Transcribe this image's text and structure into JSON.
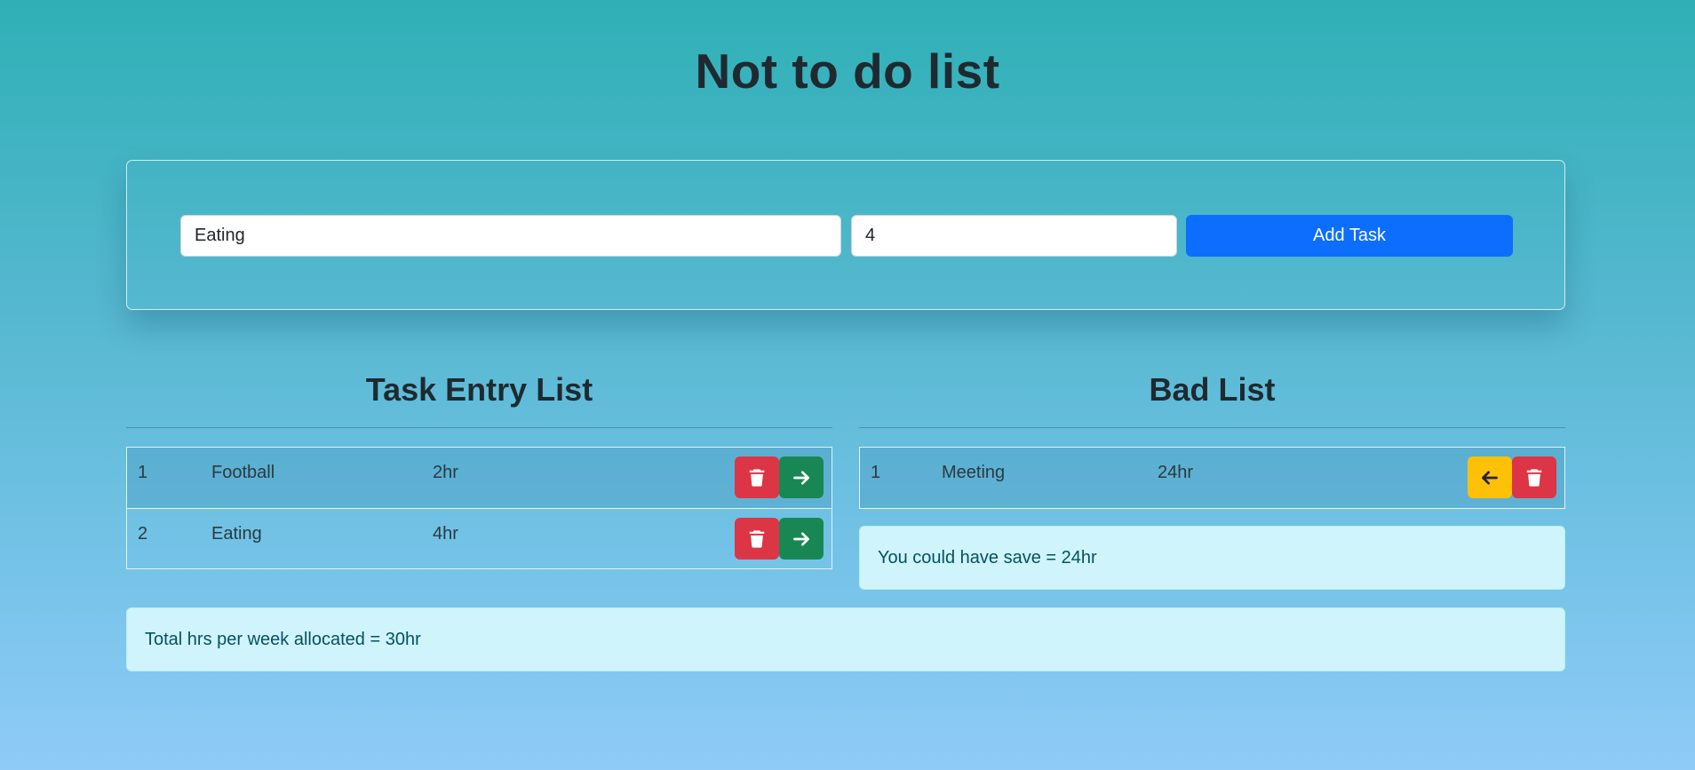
{
  "page": {
    "title": "Not to do list"
  },
  "form": {
    "task_value": "Eating",
    "hours_value": "4",
    "add_label": "Add Task"
  },
  "task_list": {
    "title": "Task Entry List",
    "rows": [
      {
        "index": "1",
        "task": "Football",
        "hours": "2hr"
      },
      {
        "index": "2",
        "task": "Eating",
        "hours": "4hr"
      }
    ]
  },
  "bad_list": {
    "title": "Bad List",
    "rows": [
      {
        "index": "1",
        "task": "Meeting",
        "hours": "24hr"
      }
    ],
    "saved_text": "You could have save = 24hr"
  },
  "summary": {
    "total_text": "Total hrs per week allocated = 30hr"
  },
  "colors": {
    "primary": "#0d6efd",
    "danger": "#dc3545",
    "success": "#198754",
    "warning": "#ffc107",
    "info_bg": "#cff4fc"
  },
  "icons": {
    "delete": "trash-icon",
    "move_right": "arrow-right-icon",
    "move_left": "arrow-left-icon"
  }
}
